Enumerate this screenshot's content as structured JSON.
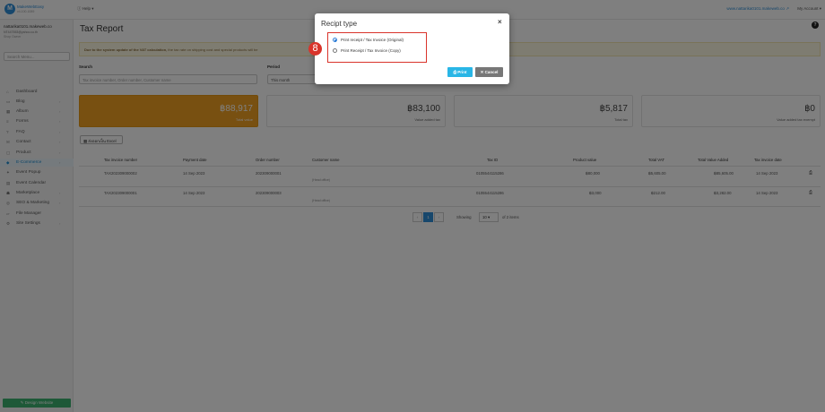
{
  "topbar": {
    "logo_letter": "M",
    "brand": "MakeWebEasy",
    "version": "v4.100.1089",
    "help": "Help",
    "site_link": "www.nattarika0101.makeweb.co",
    "account": "My Account"
  },
  "sidebar": {
    "user_email": "nattarika0101.makeweb.co",
    "user_sub": "NT447553@yahoo.co.th",
    "user_role": "Shop Owner",
    "search_placeholder": "Search Menu...",
    "items": [
      {
        "icon": "⌂",
        "label": "Dashboard",
        "chevron": ""
      },
      {
        "icon": "▭",
        "label": "Blog",
        "chevron": "›"
      },
      {
        "icon": "▦",
        "label": "Album",
        "chevron": "›"
      },
      {
        "icon": "≡",
        "label": "Forms",
        "chevron": "›"
      },
      {
        "icon": "?",
        "label": "FAQ",
        "chevron": "›"
      },
      {
        "icon": "✉",
        "label": "Contact",
        "chevron": "›"
      },
      {
        "icon": "▢",
        "label": "Product",
        "chevron": "›"
      },
      {
        "icon": "◆",
        "label": "E-Commerce",
        "chevron": "›"
      },
      {
        "icon": "✦",
        "label": "Event Popup",
        "chevron": ""
      },
      {
        "icon": "▤",
        "label": "Event Calendar",
        "chevron": ""
      },
      {
        "icon": "☗",
        "label": "Marketplace",
        "chevron": "›"
      },
      {
        "icon": "◎",
        "label": "SEO & Marketing",
        "chevron": "›"
      },
      {
        "icon": "▱",
        "label": "File Manager",
        "chevron": ""
      },
      {
        "icon": "⚙",
        "label": "Site Settings",
        "chevron": "›"
      }
    ],
    "design_button": "✎ Design Website"
  },
  "main": {
    "title": "Tax Report",
    "notice_bold": "Due to the system update of the VAT calculation,",
    "notice_rest": " the tax rate on shipping cost and special products will be",
    "search_label": "Search",
    "search_placeholder": "Tax invoice number, Order number, Customer name",
    "period_label": "Period",
    "period_value": "This month",
    "cards": [
      {
        "amount": "฿88,917",
        "caption": "Total value"
      },
      {
        "amount": "฿83,100",
        "caption": "Value added tax"
      },
      {
        "amount": "฿5,817",
        "caption": "Total tax"
      },
      {
        "amount": "฿0",
        "caption": "Value added tax exempt"
      }
    ],
    "export_label": "ส่งออกเป็น Excel",
    "table": {
      "headers": [
        "Tax invoice number",
        "Payment date",
        "Order number",
        "Customer name",
        "Tax ID",
        "Product value",
        "Total VAT",
        "Total Value Added",
        "Tax invoice date"
      ],
      "rows": [
        {
          "invoice": "TAX202309000002",
          "payment_date": "14 Sep 2023",
          "order": "202309000001",
          "customer": "",
          "customer_note": "(Head office)",
          "tax_id": "0105544115286",
          "product_value": "฿80,000",
          "total_vat": "฿5,605.00",
          "total_value_added": "฿85,605.00",
          "invoice_date": "14 Sep 2023"
        },
        {
          "invoice": "TAX202309000001",
          "payment_date": "14 Sep 2023",
          "order": "202309000003",
          "customer": "",
          "customer_note": "(Head office)",
          "tax_id": "0105544115286",
          "product_value": "฿3,000",
          "total_vat": "฿212.00",
          "total_value_added": "฿3,282.00",
          "invoice_date": "14 Sep 2023"
        }
      ]
    },
    "pagination": {
      "prev": "‹",
      "current": "1",
      "next": "›",
      "showing_label": "Showing",
      "per_page": "10",
      "of_items": "of 2 items"
    }
  },
  "modal": {
    "title": "Recipt type",
    "close": "×",
    "option_original": "Print receipt / Tax Invoice (Original)",
    "option_copy": "Print Receipt / Tax Invoice (Copy)",
    "selected": "original",
    "step_badge": "8",
    "print_button": "⎙ Print",
    "cancel_button": "✕ Cancel"
  },
  "colors": {
    "accent": "#2f8fd8",
    "gold_card": "#f0a022",
    "highlight": "#d9342b",
    "print_btn": "#29b6e6",
    "cancel_btn": "#777777"
  }
}
